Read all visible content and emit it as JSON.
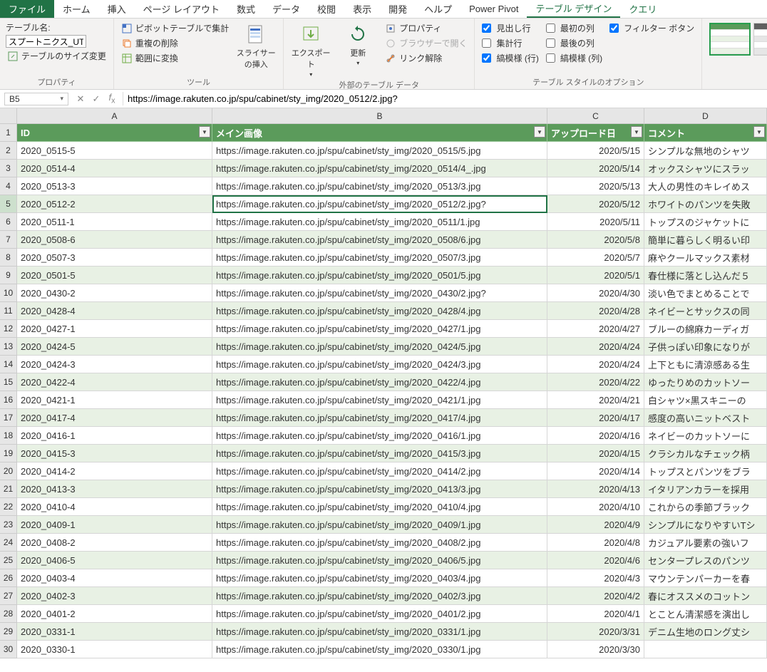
{
  "ribbon": {
    "tabs": [
      "ファイル",
      "ホーム",
      "挿入",
      "ページ レイアウト",
      "数式",
      "データ",
      "校閲",
      "表示",
      "開発",
      "ヘルプ",
      "Power Pivot",
      "テーブル デザイン",
      "クエリ"
    ],
    "active_tab": 11,
    "table_name_label": "テーブル名:",
    "table_name_value": "スプートニクス_UT",
    "resize_table": "テーブルのサイズ変更",
    "group_properties": "プロパティ",
    "pivot_summary": "ピボットテーブルで集計",
    "remove_dup": "重複の削除",
    "convert_range": "範囲に変換",
    "slicer": "スライサーの挿入",
    "group_tools": "ツール",
    "export": "エクスポート",
    "refresh": "更新",
    "props": "プロパティ",
    "open_browser": "ブラウザーで開く",
    "unlink": "リンク解除",
    "group_external": "外部のテーブル データ",
    "opt_header": "見出し行",
    "opt_total": "集計行",
    "opt_banded_row": "縞模様 (行)",
    "opt_first": "最初の列",
    "opt_last": "最後の列",
    "opt_banded_col": "縞模様 (列)",
    "opt_filter": "フィルター ボタン",
    "group_options": "テーブル スタイルのオプション"
  },
  "formula": {
    "name_box": "B5",
    "value": "https://image.rakuten.co.jp/spu/cabinet/sty_img/2020_0512/2.jpg?"
  },
  "columns": [
    "A",
    "B",
    "C",
    "D"
  ],
  "table_headers": [
    "ID",
    "メイン画像",
    "アップロード日",
    "コメント"
  ],
  "selected_cell": {
    "row": 5,
    "col": "B"
  },
  "rows": [
    {
      "n": 2,
      "id": "2020_0515-5",
      "img": "https://image.rakuten.co.jp/spu/cabinet/sty_img/2020_0515/5.jpg",
      "date": "2020/5/15",
      "cm": "シンプルな無地のシャツ"
    },
    {
      "n": 3,
      "id": "2020_0514-4",
      "img": "https://image.rakuten.co.jp/spu/cabinet/sty_img/2020_0514/4_.jpg",
      "date": "2020/5/14",
      "cm": "オックスシャツにスラッ"
    },
    {
      "n": 4,
      "id": "2020_0513-3",
      "img": "https://image.rakuten.co.jp/spu/cabinet/sty_img/2020_0513/3.jpg",
      "date": "2020/5/13",
      "cm": "大人の男性のキレイめス"
    },
    {
      "n": 5,
      "id": "2020_0512-2",
      "img": "https://image.rakuten.co.jp/spu/cabinet/sty_img/2020_0512/2.jpg?",
      "date": "2020/5/12",
      "cm": "ホワイトのパンツを失敗"
    },
    {
      "n": 6,
      "id": "2020_0511-1",
      "img": "https://image.rakuten.co.jp/spu/cabinet/sty_img/2020_0511/1.jpg",
      "date": "2020/5/11",
      "cm": "トップスのジャケットに"
    },
    {
      "n": 7,
      "id": "2020_0508-6",
      "img": "https://image.rakuten.co.jp/spu/cabinet/sty_img/2020_0508/6.jpg",
      "date": "2020/5/8",
      "cm": "簡単に暮らしく明るい印"
    },
    {
      "n": 8,
      "id": "2020_0507-3",
      "img": "https://image.rakuten.co.jp/spu/cabinet/sty_img/2020_0507/3.jpg",
      "date": "2020/5/7",
      "cm": "麻やクールマックス素材"
    },
    {
      "n": 9,
      "id": "2020_0501-5",
      "img": "https://image.rakuten.co.jp/spu/cabinet/sty_img/2020_0501/5.jpg",
      "date": "2020/5/1",
      "cm": "春仕様に落とし込んだ５"
    },
    {
      "n": 10,
      "id": "2020_0430-2",
      "img": "https://image.rakuten.co.jp/spu/cabinet/sty_img/2020_0430/2.jpg?",
      "date": "2020/4/30",
      "cm": "淡い色でまとめることで"
    },
    {
      "n": 11,
      "id": "2020_0428-4",
      "img": "https://image.rakuten.co.jp/spu/cabinet/sty_img/2020_0428/4.jpg",
      "date": "2020/4/28",
      "cm": "ネイビーとサックスの同"
    },
    {
      "n": 12,
      "id": "2020_0427-1",
      "img": "https://image.rakuten.co.jp/spu/cabinet/sty_img/2020_0427/1.jpg",
      "date": "2020/4/27",
      "cm": "ブルーの綿麻カーディガ"
    },
    {
      "n": 13,
      "id": "2020_0424-5",
      "img": "https://image.rakuten.co.jp/spu/cabinet/sty_img/2020_0424/5.jpg",
      "date": "2020/4/24",
      "cm": "子供っぽい印象になりが"
    },
    {
      "n": 14,
      "id": "2020_0424-3",
      "img": "https://image.rakuten.co.jp/spu/cabinet/sty_img/2020_0424/3.jpg",
      "date": "2020/4/24",
      "cm": "上下ともに清涼感ある生"
    },
    {
      "n": 15,
      "id": "2020_0422-4",
      "img": "https://image.rakuten.co.jp/spu/cabinet/sty_img/2020_0422/4.jpg",
      "date": "2020/4/22",
      "cm": "ゆったりめのカットソー"
    },
    {
      "n": 16,
      "id": "2020_0421-1",
      "img": "https://image.rakuten.co.jp/spu/cabinet/sty_img/2020_0421/1.jpg",
      "date": "2020/4/21",
      "cm": "白シャツ×黒スキニーの"
    },
    {
      "n": 17,
      "id": "2020_0417-4",
      "img": "https://image.rakuten.co.jp/spu/cabinet/sty_img/2020_0417/4.jpg",
      "date": "2020/4/17",
      "cm": "感度の高いニットベスト"
    },
    {
      "n": 18,
      "id": "2020_0416-1",
      "img": "https://image.rakuten.co.jp/spu/cabinet/sty_img/2020_0416/1.jpg",
      "date": "2020/4/16",
      "cm": "ネイビーのカットソーに"
    },
    {
      "n": 19,
      "id": "2020_0415-3",
      "img": "https://image.rakuten.co.jp/spu/cabinet/sty_img/2020_0415/3.jpg",
      "date": "2020/4/15",
      "cm": "クラシカルなチェック柄"
    },
    {
      "n": 20,
      "id": "2020_0414-2",
      "img": "https://image.rakuten.co.jp/spu/cabinet/sty_img/2020_0414/2.jpg",
      "date": "2020/4/14",
      "cm": "トップスとパンツをブラ"
    },
    {
      "n": 21,
      "id": "2020_0413-3",
      "img": "https://image.rakuten.co.jp/spu/cabinet/sty_img/2020_0413/3.jpg",
      "date": "2020/4/13",
      "cm": "イタリアンカラーを採用"
    },
    {
      "n": 22,
      "id": "2020_0410-4",
      "img": "https://image.rakuten.co.jp/spu/cabinet/sty_img/2020_0410/4.jpg",
      "date": "2020/4/10",
      "cm": "これからの季節ブラック"
    },
    {
      "n": 23,
      "id": "2020_0409-1",
      "img": "https://image.rakuten.co.jp/spu/cabinet/sty_img/2020_0409/1.jpg",
      "date": "2020/4/9",
      "cm": "シンプルになりやすいTシ"
    },
    {
      "n": 24,
      "id": "2020_0408-2",
      "img": "https://image.rakuten.co.jp/spu/cabinet/sty_img/2020_0408/2.jpg",
      "date": "2020/4/8",
      "cm": "カジュアル要素の強いフ"
    },
    {
      "n": 25,
      "id": "2020_0406-5",
      "img": "https://image.rakuten.co.jp/spu/cabinet/sty_img/2020_0406/5.jpg",
      "date": "2020/4/6",
      "cm": "センタープレスのパンツ"
    },
    {
      "n": 26,
      "id": "2020_0403-4",
      "img": "https://image.rakuten.co.jp/spu/cabinet/sty_img/2020_0403/4.jpg",
      "date": "2020/4/3",
      "cm": "マウンテンパーカーを春"
    },
    {
      "n": 27,
      "id": "2020_0402-3",
      "img": "https://image.rakuten.co.jp/spu/cabinet/sty_img/2020_0402/3.jpg",
      "date": "2020/4/2",
      "cm": "春にオススメのコットン"
    },
    {
      "n": 28,
      "id": "2020_0401-2",
      "img": "https://image.rakuten.co.jp/spu/cabinet/sty_img/2020_0401/2.jpg",
      "date": "2020/4/1",
      "cm": "とことん清潔感を演出し"
    },
    {
      "n": 29,
      "id": "2020_0331-1",
      "img": "https://image.rakuten.co.jp/spu/cabinet/sty_img/2020_0331/1.jpg",
      "date": "2020/3/31",
      "cm": "デニム生地のロング丈シ"
    },
    {
      "n": 30,
      "id": "2020_0330-1",
      "img": "https://image.rakuten.co.jp/spu/cabinet/sty_img/2020_0330/1.jpg",
      "date": "2020/3/30",
      "cm": ""
    }
  ]
}
